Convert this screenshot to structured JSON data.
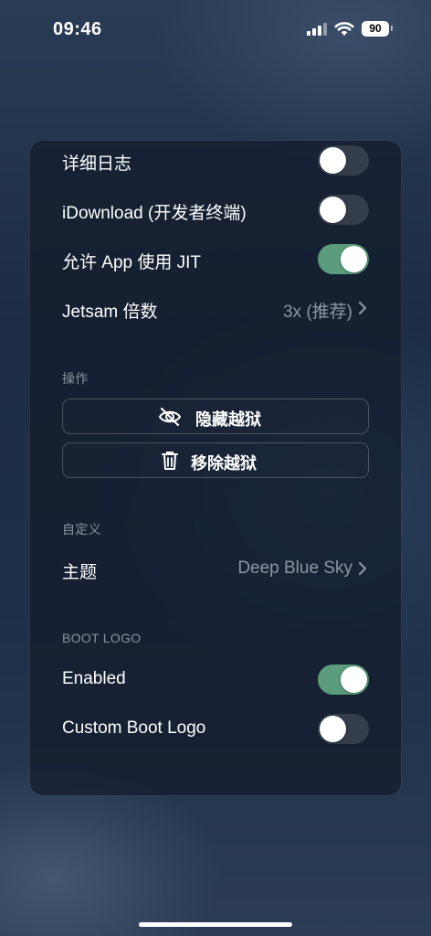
{
  "status_bar": {
    "time": "09:46",
    "battery": "90"
  },
  "settings": {
    "verbose_log": {
      "label": "详细日志",
      "on": false
    },
    "idownload": {
      "label": "iDownload (开发者终端)",
      "on": false
    },
    "allow_jit": {
      "label": "允许 App 使用 JIT",
      "on": true
    },
    "jetsam": {
      "label": "Jetsam 倍数",
      "value": "3x (推荐)"
    }
  },
  "actions": {
    "header": "操作",
    "hide_label": "隐藏越狱",
    "remove_label": "移除越狱"
  },
  "customize": {
    "header": "自定义",
    "theme_label": "主题",
    "theme_value": "Deep Blue Sky"
  },
  "boot_logo": {
    "header": "BOOT LOGO",
    "enabled": {
      "label": "Enabled",
      "on": true
    },
    "custom": {
      "label": "Custom Boot Logo",
      "on": false
    }
  },
  "colors": {
    "toggle_on": "#5b9c7c",
    "toggle_off": "#343d4a",
    "panel": "#121c2a"
  },
  "icons": [
    "cellular-signal-icon",
    "wifi-icon",
    "battery-icon",
    "eye-slash-icon",
    "trash-icon",
    "chevron-right-icon"
  ]
}
